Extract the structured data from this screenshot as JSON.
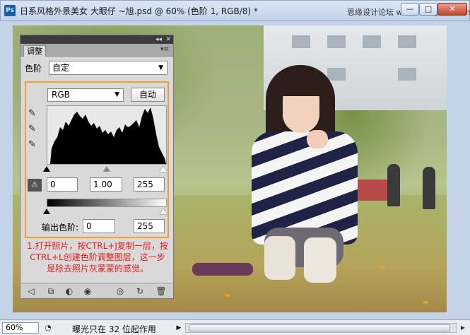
{
  "window": {
    "title": "日系风格外景美女  大眼仔 ~旭.psd @ 60% (色阶 1, RGB/8) *",
    "app_icon": "Ps",
    "watermark": "思缘设计论坛 www.missyuan.com",
    "minimize": "—",
    "maximize": "□",
    "close": "✕"
  },
  "panel": {
    "tab_label": "调整",
    "collapse": "◂◂",
    "close": "✕",
    "menu": "▾≡",
    "preset_label": "色阶",
    "preset_value": "自定",
    "channel_value": "RGB",
    "auto_label": "自动",
    "input_black": "0",
    "input_gamma": "1.00",
    "input_white": "255",
    "output_label": "输出色阶:",
    "output_black": "0",
    "output_white": "255",
    "note": "1.打开照片，按CTRL+J复制一层，按CTRL+L创建色阶调整图层，这一步是除去照片灰蒙蒙的感觉。"
  },
  "status": {
    "zoom": "60%",
    "message": "曝光只在 32 位起作用",
    "arrow": "▶",
    "scroll_right": "▶"
  },
  "colors": {
    "accent_box": "#f0a030",
    "note_text": "#e02020"
  }
}
